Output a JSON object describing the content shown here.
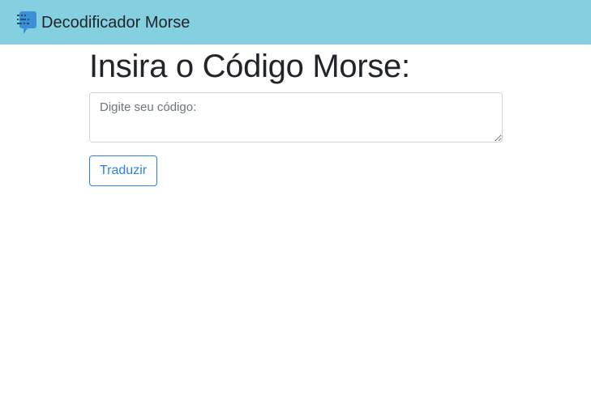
{
  "navbar": {
    "brand_text": "Decodificador Morse",
    "brand_icon": "morse-chat-icon",
    "background_color": "#84d0e0",
    "icon_color": "#3a8fd6"
  },
  "main": {
    "title": "Insira o Código Morse:",
    "code_input": {
      "value": "",
      "placeholder": "Digite seu código:"
    },
    "translate_button_label": "Traduzir",
    "accent_color": "#2f7fe0"
  }
}
